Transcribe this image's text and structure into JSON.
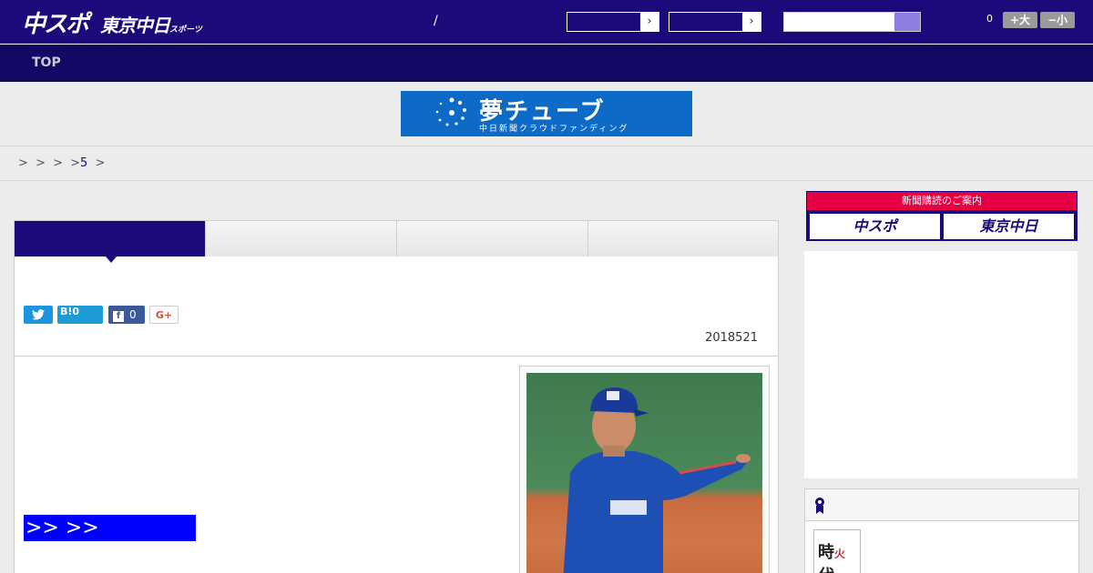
{
  "header": {
    "logo_primary": "中スポ",
    "logo_secondary": "東京中日",
    "logo_secondary_small": "スポーツ",
    "separator": "/",
    "dropdown_arrow": "›",
    "cart_count": "0",
    "font_increase_label": "+大",
    "font_decrease_label": "−小"
  },
  "nav": {
    "items": [
      {
        "label": "TOP"
      }
    ]
  },
  "banner": {
    "title": "夢チューブ",
    "subtitle": "中日新聞クラウドファンディング",
    "background": "#0d6bc7"
  },
  "breadcrumb": {
    "sep1": ">",
    "sep2": ">",
    "sep3": ">",
    "sep4": ">",
    "link": "5",
    "sep5": ">"
  },
  "article": {
    "share": {
      "twitter_icon": "twitter-icon",
      "hatena_label": "B!0",
      "facebook_count": "0",
      "facebook_icon_glyph": "f",
      "googleplus_label": "G+"
    },
    "date": "2018521",
    "more_link": ">> >>"
  },
  "sidebar": {
    "subscription": {
      "heading": "新聞購読のご案内",
      "button1": "中スポ",
      "button2": "東京中日"
    },
    "ranking": {
      "thumb_text_1": "時",
      "thumb_text_2": "代",
      "thumb_accent": "火"
    }
  },
  "colors": {
    "header_bg": "#1a0a7a",
    "nav_bg": "#130863",
    "accent_red": "#e60044",
    "more_link_bg": "#0000ff"
  }
}
